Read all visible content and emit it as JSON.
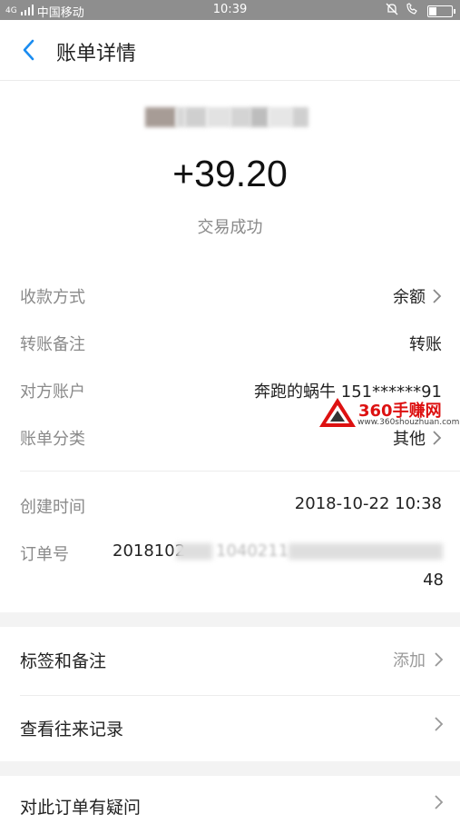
{
  "status_bar": {
    "signal": "4G",
    "carrier": "中国移动",
    "time": "10:39"
  },
  "nav": {
    "title": "账单详情"
  },
  "transaction": {
    "amount": "+39.20",
    "status": "交易成功"
  },
  "details": [
    {
      "label": "收款方式",
      "value": "余额"
    },
    {
      "label": "转账备注",
      "value": "转账"
    },
    {
      "label": "对方账户",
      "value": "奔跑的蜗牛 151******91"
    },
    {
      "label": "账单分类",
      "value": "其他"
    },
    {
      "label": "创建时间",
      "value": "2018-10-22 10:38"
    },
    {
      "label": "订单号",
      "value_start": "2018102",
      "value_mid": "1040211",
      "value_end": "48"
    }
  ],
  "actions": [
    {
      "label": "标签和备注",
      "value": "添加"
    },
    {
      "label": "查看往来记录",
      "value": ""
    },
    {
      "label": "对此订单有疑问",
      "value": ""
    }
  ],
  "watermark": {
    "text": "360手赚网",
    "url": "www.360shouzhuan.com"
  },
  "colors": {
    "accent": "#1a8cf0",
    "status_bar": "#8e8e8e",
    "label_gray": "#8a8a8a",
    "watermark_red": "#dd1111"
  }
}
